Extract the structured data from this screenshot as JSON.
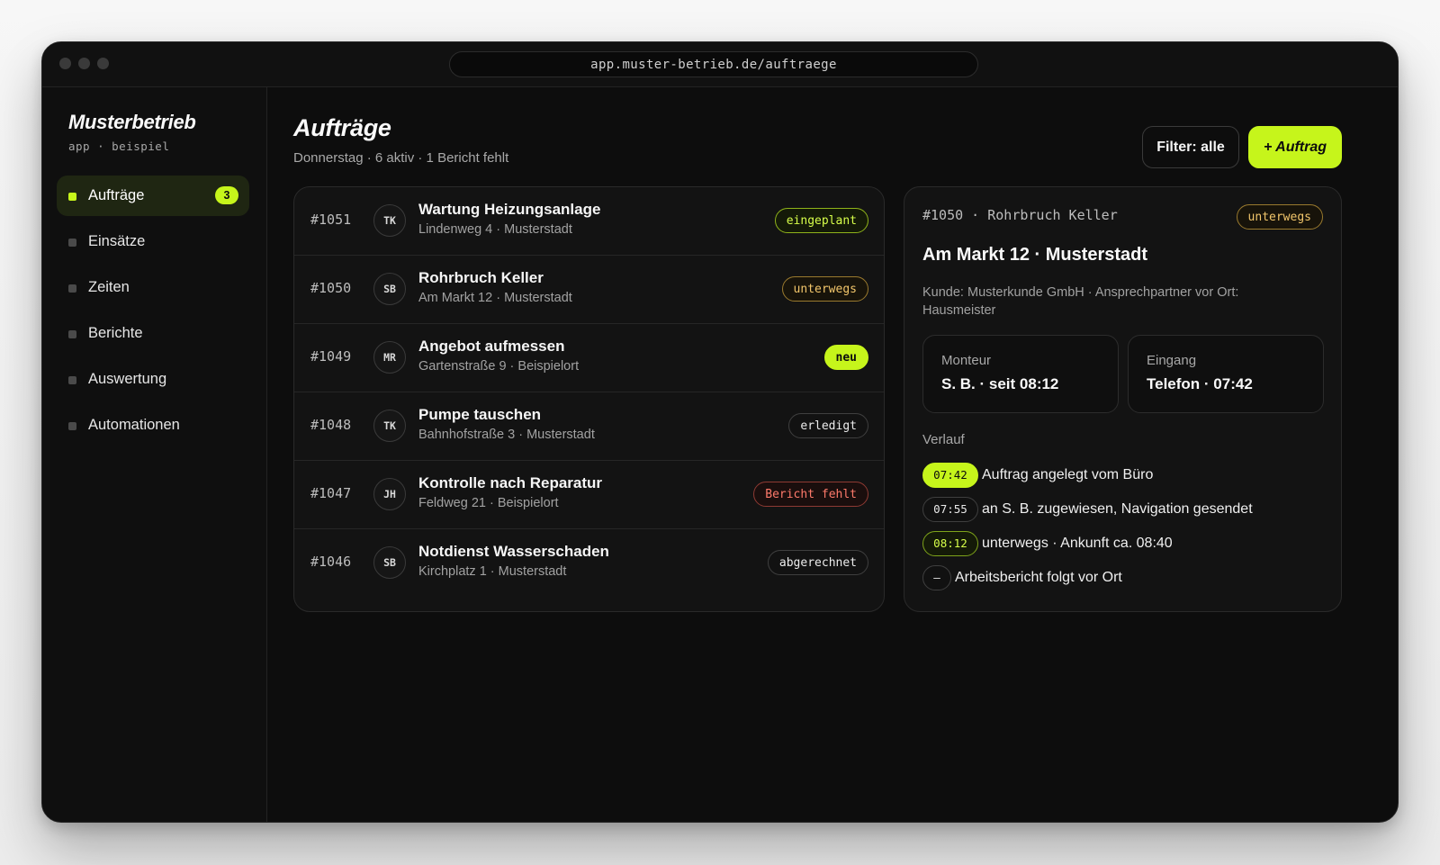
{
  "browser": {
    "url": "app.muster-betrieb.de/auftraege"
  },
  "sidebar": {
    "brand": "Musterbetrieb",
    "brand_sub": "app · beispiel",
    "items": [
      {
        "label": "Aufträge",
        "badge": "3",
        "active": true
      },
      {
        "label": "Einsätze"
      },
      {
        "label": "Zeiten"
      },
      {
        "label": "Berichte"
      },
      {
        "label": "Auswertung"
      },
      {
        "label": "Automationen"
      }
    ]
  },
  "header": {
    "title": "Aufträge",
    "subtitle": "Donnerstag · 6 aktiv · 1 Bericht fehlt",
    "filter_label": "Filter: alle",
    "add_label": "+ Auftrag"
  },
  "orders": [
    {
      "id": "#1051",
      "initials": "TK",
      "title": "Wartung Heizungsanlage",
      "address": "Lindenweg 4 · Musterstadt",
      "status": "eingeplant"
    },
    {
      "id": "#1050",
      "initials": "SB",
      "title": "Rohrbruch Keller",
      "address": "Am Markt 12 · Musterstadt",
      "status": "unterwegs"
    },
    {
      "id": "#1049",
      "initials": "MR",
      "title": "Angebot aufmessen",
      "address": "Gartenstraße 9 · Beispielort",
      "status": "neu"
    },
    {
      "id": "#1048",
      "initials": "TK",
      "title": "Pumpe tauschen",
      "address": "Bahnhofstraße 3 · Musterstadt",
      "status": "erledigt"
    },
    {
      "id": "#1047",
      "initials": "JH",
      "title": "Kontrolle nach Reparatur",
      "address": "Feldweg 21 · Beispielort",
      "status": "Bericht fehlt"
    },
    {
      "id": "#1046",
      "initials": "SB",
      "title": "Notdienst Wasserschaden",
      "address": "Kirchplatz 1 · Musterstadt",
      "status": "abgerechnet"
    }
  ],
  "detail": {
    "header": "#1050 · Rohrbruch Keller",
    "status": "unterwegs",
    "title": "Am Markt 12 · Musterstadt",
    "customer": "Kunde: Musterkunde GmbH · Ansprechpartner vor Ort: Hausmeister",
    "info": [
      {
        "label": "Monteur",
        "value": "S. B. · seit 08:12"
      },
      {
        "label": "Eingang",
        "value": "Telefon · 07:42"
      }
    ],
    "history_label": "Verlauf",
    "history": [
      {
        "time": "07:42",
        "text": "Auftrag angelegt vom Büro"
      },
      {
        "time": "07:55",
        "text": "an S. B. zugewiesen, Navigation gesendet"
      },
      {
        "time": "08:12",
        "text": "unterwegs · Ankunft ca. 08:40"
      },
      {
        "time": "–",
        "text": "Arbeitsbericht folgt vor Ort"
      }
    ]
  },
  "colors": {
    "accent": "#c6f51b",
    "background": "#0d0d0d",
    "status_amber": "#f2c66b",
    "status_red": "#ff7a6b"
  }
}
